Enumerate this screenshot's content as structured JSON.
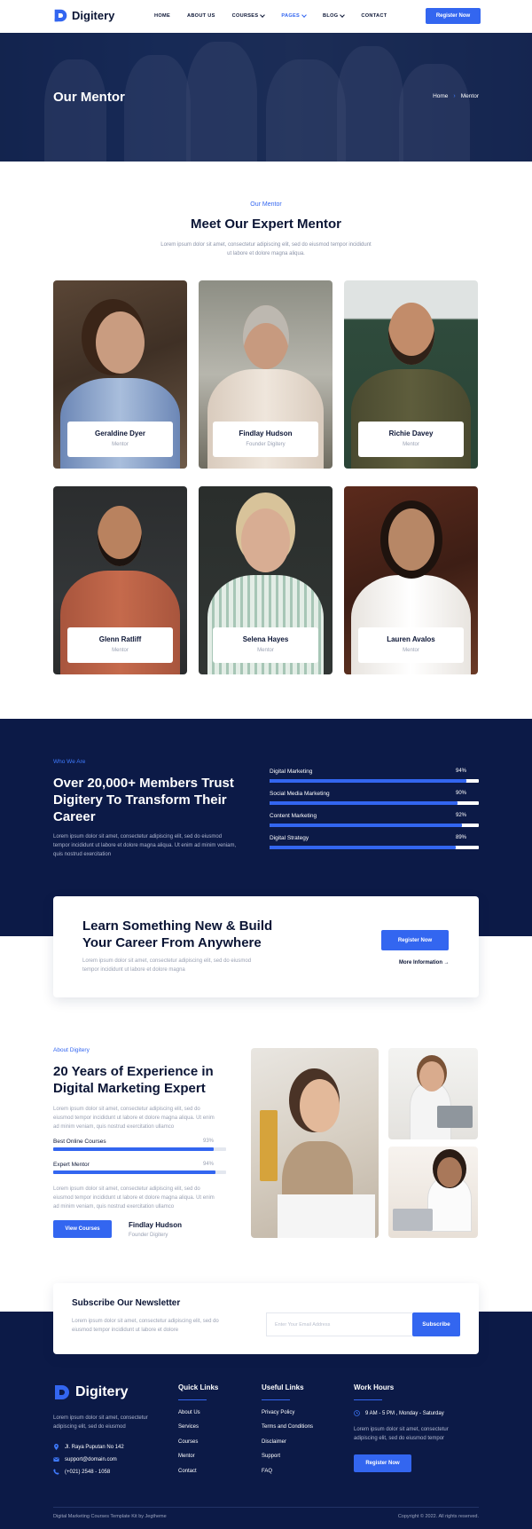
{
  "nav": {
    "brand": "Digitery",
    "menu": [
      {
        "label": "HOME",
        "has_dropdown": false,
        "active": false
      },
      {
        "label": "ABOUT US",
        "has_dropdown": false,
        "active": false
      },
      {
        "label": "COURSES",
        "has_dropdown": true,
        "active": false
      },
      {
        "label": "PAGES",
        "has_dropdown": true,
        "active": true
      },
      {
        "label": "BLOG",
        "has_dropdown": true,
        "active": false
      },
      {
        "label": "CONTACT",
        "has_dropdown": false,
        "active": false
      }
    ],
    "cta_label": "Register Now"
  },
  "hero": {
    "title": "Our Mentor",
    "breadcrumb": [
      "Home",
      "Mentor"
    ]
  },
  "mentors_section": {
    "tag": "Our Mentor",
    "title": "Meet Our Expert Mentor",
    "description": "Lorem ipsum dolor sit amet, consectetur adipiscing elit, sed do eiusmod tempor incididunt ut labore et dolore magna aliqua.",
    "mentors": [
      {
        "name": "Geraldine Dyer",
        "role": "Mentor"
      },
      {
        "name": "Findlay Hudson",
        "role": "Founder Digitery"
      },
      {
        "name": "Richie Davey",
        "role": "Mentor"
      },
      {
        "name": "Glenn Ratliff",
        "role": "Mentor"
      },
      {
        "name": "Selena Hayes",
        "role": "Mentor"
      },
      {
        "name": "Lauren Avalos",
        "role": "Mentor"
      }
    ]
  },
  "who_we_are": {
    "tag": "Who We Are",
    "title": "Over 20,000+ Members Trust Digitery To Transform Their Career",
    "description": "Lorem ipsum dolor sit amet, consectetur adipiscing elit, sed do eiusmod tempor incididunt ut labore et dolore magna aliqua. Ut enim ad minim veniam, quis nostrud exercitation",
    "skills": [
      {
        "label": "Digital Marketing",
        "percent_text": "94%",
        "percent": 94
      },
      {
        "label": "Social Media Marketing",
        "percent_text": "90%",
        "percent": 90
      },
      {
        "label": "Content Marketing",
        "percent_text": "92%",
        "percent": 92
      },
      {
        "label": "Digital Strategy",
        "percent_text": "89%",
        "percent": 89
      }
    ]
  },
  "cta": {
    "title": "Learn Something New & Build Your Career From Anywhere",
    "description": "Lorem ipsum dolor sit amet, consectetur adipiscing elit, sed do eiusmod tempor incididunt ut labore et dolore magna",
    "button": "Register Now",
    "link": "More Information"
  },
  "about": {
    "tag": "About Digitery",
    "title": "20 Years of Experience in Digital Marketing Expert",
    "description_1": "Lorem ipsum dolor sit amet, consectetur adipiscing elit, sed do eiusmod tempor incididunt ut labore et dolore magna aliqua. Ut enim ad minim veniam, quis nostrud exercitation ullamco",
    "skills": [
      {
        "label": "Best Online Courses",
        "percent_text": "93%",
        "percent": 93
      },
      {
        "label": "Expert Mentor",
        "percent_text": "94%",
        "percent": 94
      }
    ],
    "description_2": "Lorem ipsum dolor sit amet, consectetur adipiscing elit, sed do eiusmod tempor incididunt ut labore et dolore magna aliqua. Ut enim ad minim veniam, quis nostrud exercitation ullamco",
    "button": "View Courses",
    "person_name": "Findlay Hudson",
    "person_role": "Founder Digitery"
  },
  "newsletter": {
    "title": "Subscribe Our Newsletter",
    "description": "Lorem ipsum dolor sit amet, consectetur adipiscing elit, sed do eiusmod tempor incididunt ut labore et dolore",
    "placeholder": "Enter Your Email Address",
    "button": "Subscribe"
  },
  "footer": {
    "brand": "Digitery",
    "description": "Lorem ipsum dolor sit amet, consectetur adipiscing elit, sed do eiusmod",
    "address": "Jl. Raya Puputan No 142",
    "email": "support@domain.com",
    "phone": "(+021) 2548 - 1058",
    "quick_links_title": "Quick Links",
    "quick_links": [
      "About Us",
      "Services",
      "Courses",
      "Mentor",
      "Contact"
    ],
    "useful_links_title": "Useful Links",
    "useful_links": [
      "Privacy Policy",
      "Terms and Conditions",
      "Disclaimer",
      "Support",
      "FAQ"
    ],
    "work_hours_title": "Work Hours",
    "work_hours": "9 AM - 5 PM , Monday - Saturday",
    "work_desc": "Lorem ipsum dolor sit amet, consectetur adipiscing elit, sed do eiusmod tempor",
    "work_button": "Register Now",
    "credit": "Digital Marketing Courses Template Kit by Jegtheme",
    "copyright": "Copyright © 2022. All rights reserved."
  },
  "colors": {
    "accent": "#3366f0",
    "dark": "#0c1a47",
    "heading": "#0b1535",
    "muted": "#9aa1b3"
  }
}
